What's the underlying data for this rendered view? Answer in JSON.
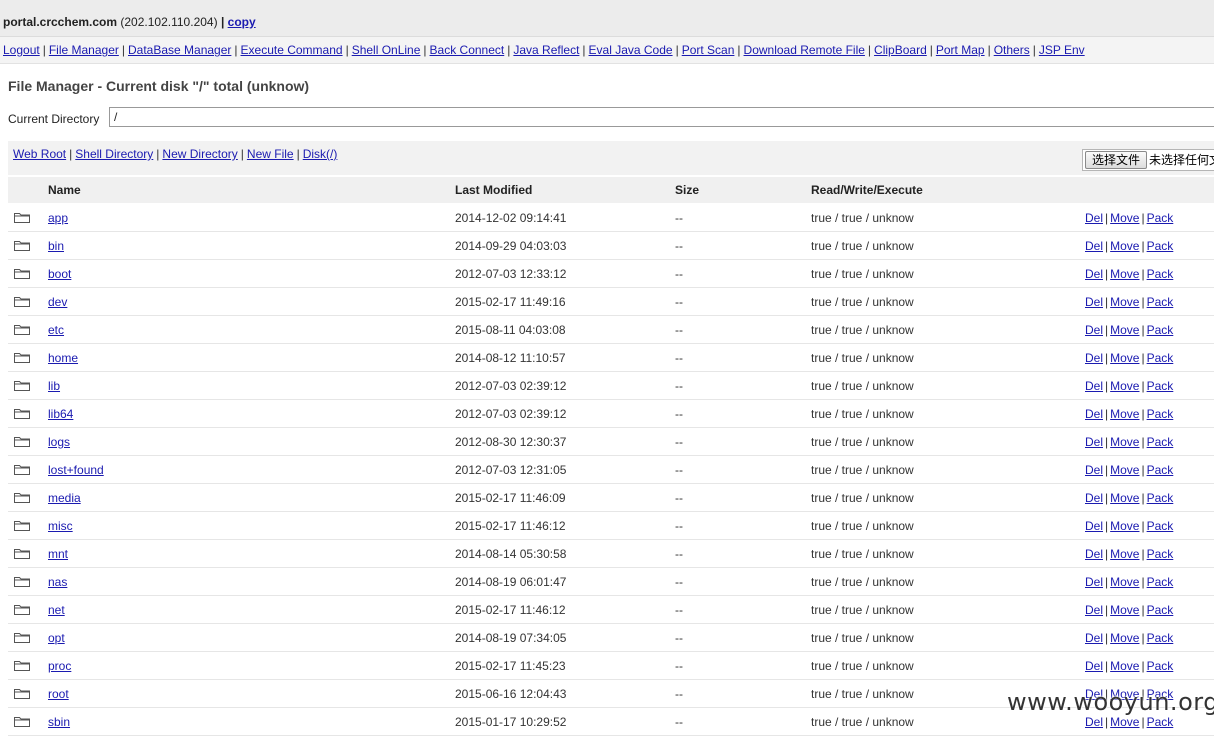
{
  "topbar": {
    "host": "portal.crcchem.com",
    "ip": "(202.102.110.204)",
    "sep": "|",
    "copy_label": "copy"
  },
  "nav": {
    "items": [
      "Logout",
      "File Manager",
      "DataBase Manager",
      "Execute Command",
      "Shell OnLine",
      "Back Connect",
      "Java Reflect",
      "Eval Java Code",
      "Port Scan",
      "Download Remote File",
      "ClipBoard",
      "Port Map",
      "Others",
      "JSP Env"
    ]
  },
  "page": {
    "title": "File Manager - Current disk \"/\" total (unknow)",
    "current_directory_label": "Current Directory",
    "current_directory_value": "/"
  },
  "toolbar": {
    "links": [
      "Web Root",
      "Shell Directory",
      "New Directory",
      "New File",
      "Disk(/)"
    ],
    "file_button": "选择文件",
    "file_status": "未选择任何文件"
  },
  "table": {
    "headers": {
      "name": "Name",
      "modified": "Last Modified",
      "size": "Size",
      "rwx": "Read/Write/Execute"
    },
    "actions": [
      "Del",
      "Move",
      "Pack"
    ],
    "rows": [
      {
        "name": "app",
        "modified": "2014-12-02 09:14:41",
        "size": "--",
        "rwx": "true / true / unknow"
      },
      {
        "name": "bin",
        "modified": "2014-09-29 04:03:03",
        "size": "--",
        "rwx": "true / true / unknow"
      },
      {
        "name": "boot",
        "modified": "2012-07-03 12:33:12",
        "size": "--",
        "rwx": "true / true / unknow"
      },
      {
        "name": "dev",
        "modified": "2015-02-17 11:49:16",
        "size": "--",
        "rwx": "true / true / unknow"
      },
      {
        "name": "etc",
        "modified": "2015-08-11 04:03:08",
        "size": "--",
        "rwx": "true / true / unknow"
      },
      {
        "name": "home",
        "modified": "2014-08-12 11:10:57",
        "size": "--",
        "rwx": "true / true / unknow"
      },
      {
        "name": "lib",
        "modified": "2012-07-03 02:39:12",
        "size": "--",
        "rwx": "true / true / unknow"
      },
      {
        "name": "lib64",
        "modified": "2012-07-03 02:39:12",
        "size": "--",
        "rwx": "true / true / unknow"
      },
      {
        "name": "logs",
        "modified": "2012-08-30 12:30:37",
        "size": "--",
        "rwx": "true / true / unknow"
      },
      {
        "name": "lost+found",
        "modified": "2012-07-03 12:31:05",
        "size": "--",
        "rwx": "true / true / unknow"
      },
      {
        "name": "media",
        "modified": "2015-02-17 11:46:09",
        "size": "--",
        "rwx": "true / true / unknow"
      },
      {
        "name": "misc",
        "modified": "2015-02-17 11:46:12",
        "size": "--",
        "rwx": "true / true / unknow"
      },
      {
        "name": "mnt",
        "modified": "2014-08-14 05:30:58",
        "size": "--",
        "rwx": "true / true / unknow"
      },
      {
        "name": "nas",
        "modified": "2014-08-19 06:01:47",
        "size": "--",
        "rwx": "true / true / unknow"
      },
      {
        "name": "net",
        "modified": "2015-02-17 11:46:12",
        "size": "--",
        "rwx": "true / true / unknow"
      },
      {
        "name": "opt",
        "modified": "2014-08-19 07:34:05",
        "size": "--",
        "rwx": "true / true / unknow"
      },
      {
        "name": "proc",
        "modified": "2015-02-17 11:45:23",
        "size": "--",
        "rwx": "true / true / unknow"
      },
      {
        "name": "root",
        "modified": "2015-06-16 12:04:43",
        "size": "--",
        "rwx": "true / true / unknow"
      },
      {
        "name": "sbin",
        "modified": "2015-01-17 10:29:52",
        "size": "--",
        "rwx": "true / true / unknow"
      }
    ]
  },
  "watermark": "www.wooyun.org",
  "icons": {
    "row": "folder-icon"
  },
  "colors": {
    "link": "#1a1ab0",
    "header_bg": "#f0f0f0",
    "topbar_bg": "#ececec"
  }
}
